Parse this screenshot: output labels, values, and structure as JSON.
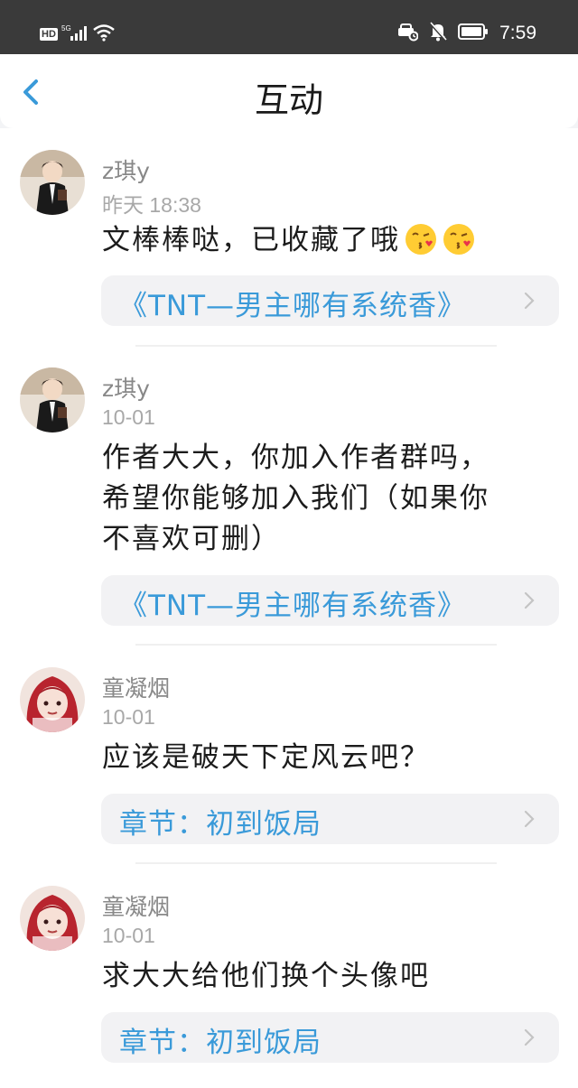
{
  "status_bar": {
    "network_badge": "HD",
    "signal_label": "5G",
    "time": "7:59",
    "icons": [
      "signal-icon",
      "wifi-icon",
      "car-icon",
      "bell-off-icon",
      "battery-icon"
    ]
  },
  "header": {
    "title": "互动",
    "back_icon": "chevron-left-icon"
  },
  "colors": {
    "link": "#3a9ad9",
    "muted": "#888888"
  },
  "comments": [
    {
      "user": "z琪y",
      "time": "昨天 18:38",
      "text": "文棒棒哒，已收藏了哦",
      "emoji": [
        "kiss-emoji",
        "kiss-emoji"
      ],
      "ref": "《TNT—男主哪有系统香》"
    },
    {
      "user": "z琪y",
      "time": "10-01",
      "text_lines": [
        "作者大大，你加入作者群吗，",
        "希望你能够加入我们（如果你",
        "不喜欢可删）"
      ],
      "ref": "《TNT—男主哪有系统香》"
    },
    {
      "user": "童凝烟",
      "time": "10-01",
      "text": "应该是破天下定风云吧？",
      "ref": "章节：初到饭局"
    },
    {
      "user": "童凝烟",
      "time": "10-01",
      "text": "求大大给他们换个头像吧",
      "ref": "章节：初到饭局"
    }
  ]
}
